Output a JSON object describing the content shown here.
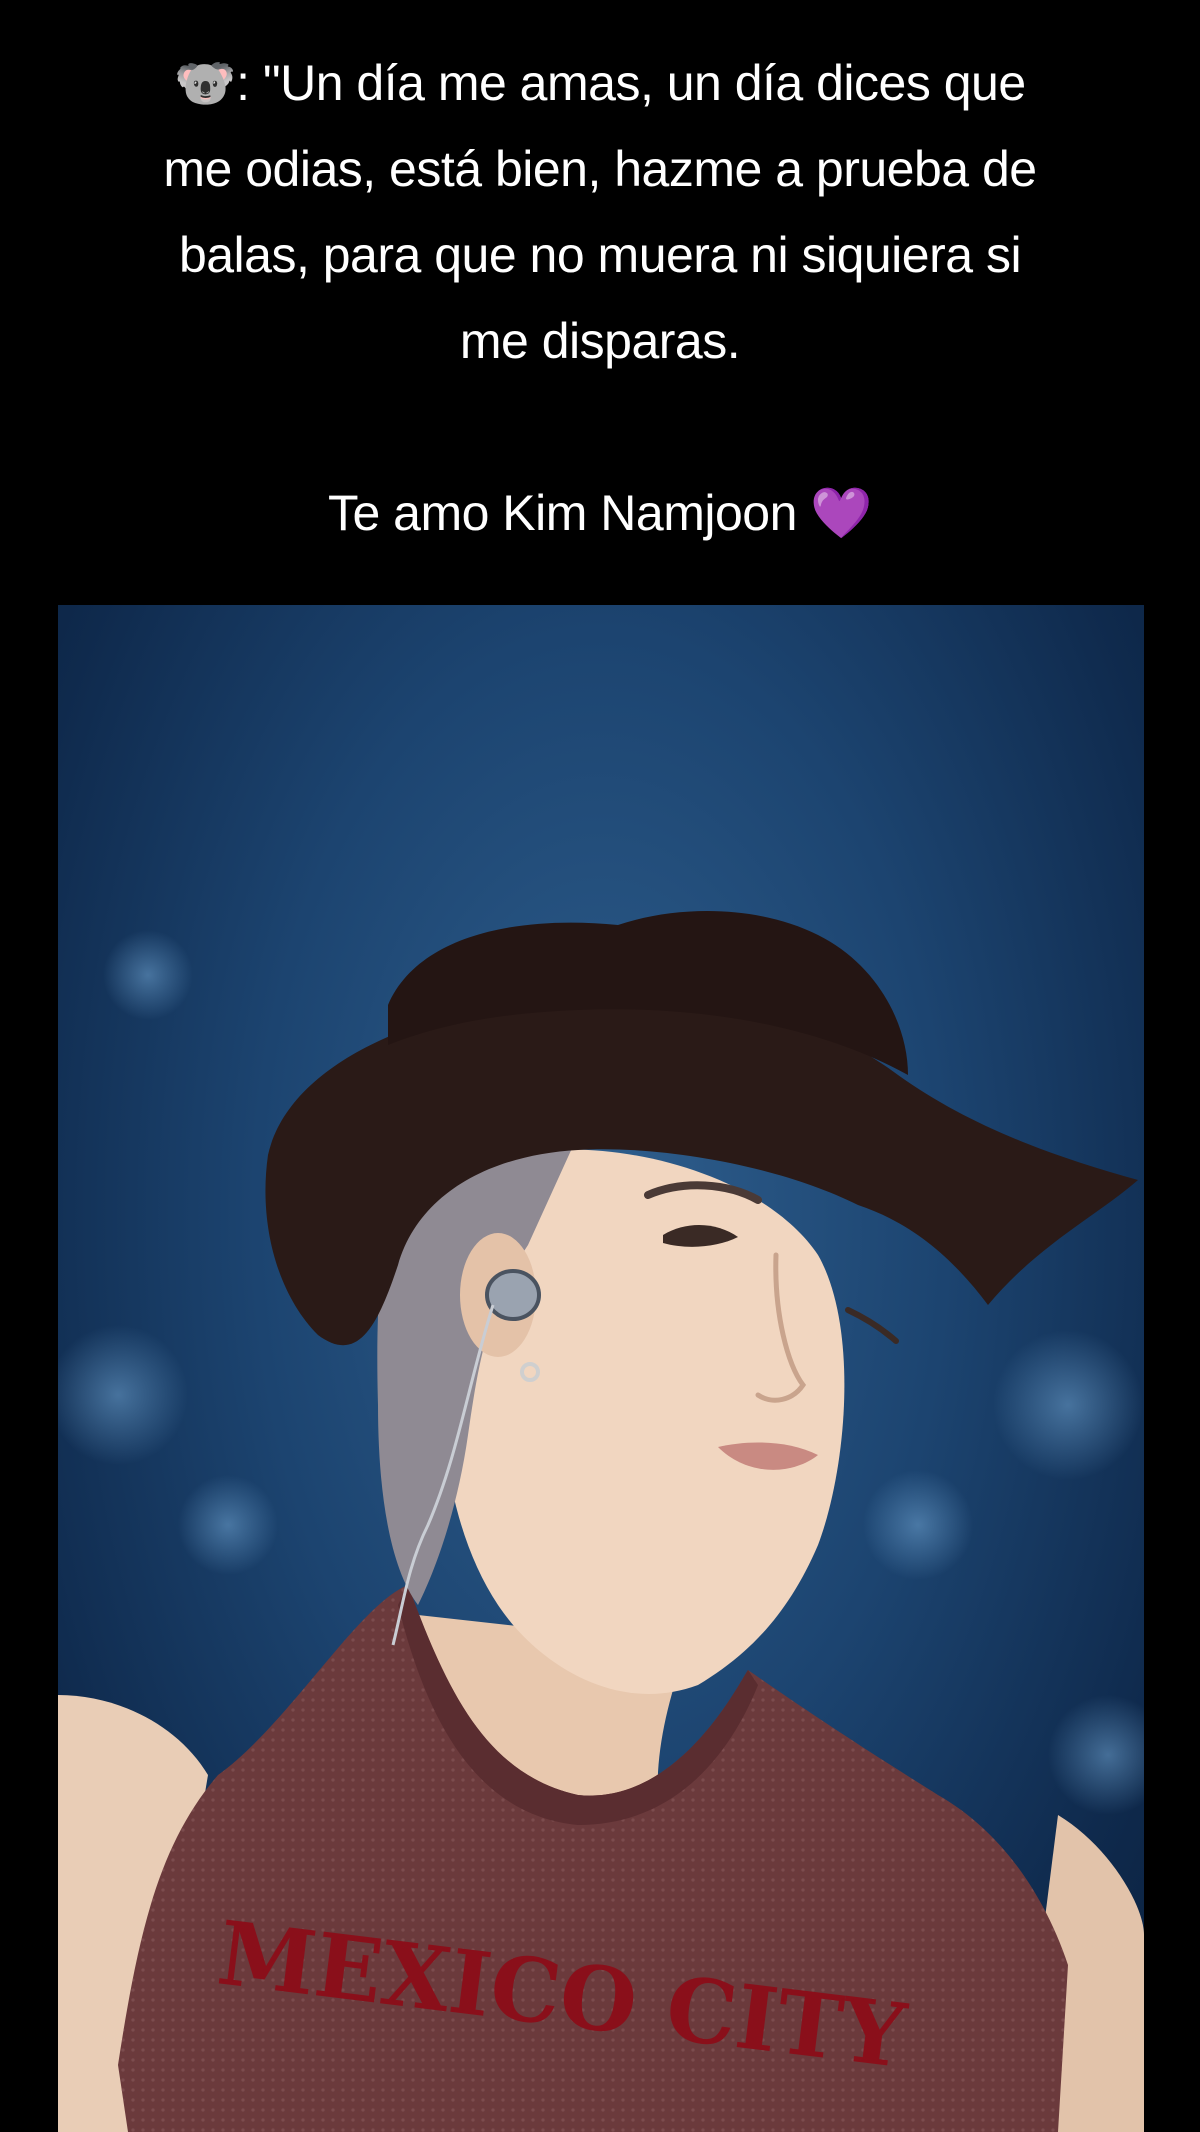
{
  "caption": {
    "lines": [
      "🐨: \"Un día me amas, un día dices que",
      "me odias, está bien, hazme a prueba de",
      "balas, para que no muera ni siquiera si",
      "me disparas.",
      "Te amo Kim Namjoon 💜"
    ]
  },
  "photo": {
    "shirt_text": "MEXICO CITY"
  },
  "colors": {
    "background": "#000000",
    "text": "#ffffff",
    "photo_backdrop": "#1c4470",
    "hat": "#2a1a17",
    "shirt": "#6b3a3c",
    "shirt_lettering": "#8a0f1a"
  }
}
